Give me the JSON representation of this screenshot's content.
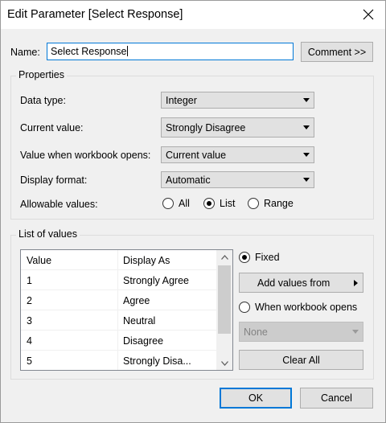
{
  "window": {
    "title": "Edit Parameter [Select Response]",
    "close_icon": "close-icon"
  },
  "name": {
    "label": "Name:",
    "value": "Select Response",
    "comment_button": "Comment >>"
  },
  "properties": {
    "title": "Properties",
    "data_type": {
      "label": "Data type:",
      "value": "Integer"
    },
    "current_value": {
      "label": "Current value:",
      "value": "Strongly Disagree"
    },
    "workbook_opens": {
      "label": "Value when workbook opens:",
      "value": "Current value"
    },
    "display_format": {
      "label": "Display format:",
      "value": "Automatic"
    },
    "allowable": {
      "label": "Allowable values:",
      "options": [
        "All",
        "List",
        "Range"
      ],
      "selected": "List"
    }
  },
  "list_of_values": {
    "title": "List of values",
    "columns": [
      "Value",
      "Display As"
    ],
    "rows": [
      [
        "1",
        "Strongly Agree"
      ],
      [
        "2",
        "Agree"
      ],
      [
        "3",
        "Neutral"
      ],
      [
        "4",
        "Disagree"
      ],
      [
        "5",
        "Strongly Disa..."
      ]
    ],
    "fixed_label": "Fixed",
    "add_values_button": "Add values from",
    "when_opens_label": "When workbook opens",
    "when_opens_select": "None",
    "clear_all_button": "Clear All",
    "selected_option": "Fixed"
  },
  "footer": {
    "ok": "OK",
    "cancel": "Cancel"
  },
  "colors": {
    "focus": "#0078d7",
    "button_bg": "#e1e1e1",
    "window_bg": "#f0f0f0"
  }
}
